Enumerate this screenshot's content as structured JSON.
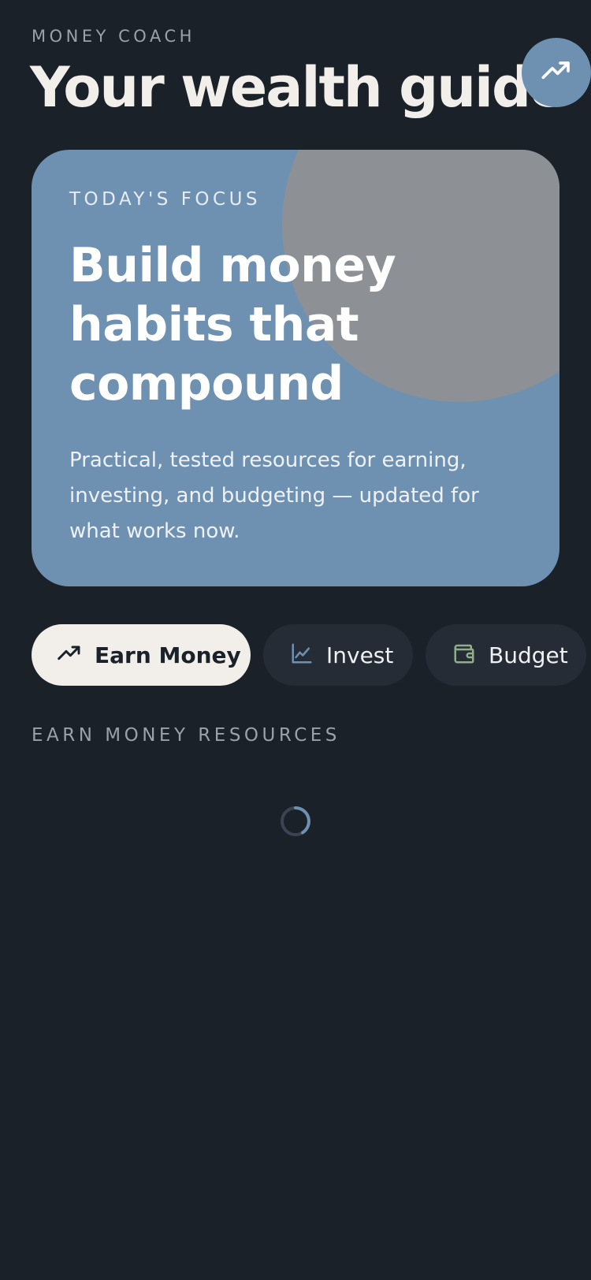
{
  "header": {
    "eyebrow": "MONEY COACH",
    "title": "Your wealth guide",
    "action_icon": "trending-up-icon"
  },
  "hero": {
    "eyebrow": "TODAY'S FOCUS",
    "title": "Build money habits that compound",
    "description": "Practical, tested resources for earning, investing, and budgeting — updated for what works now."
  },
  "categories": [
    {
      "label": "Earn Money",
      "icon": "trending-up-icon",
      "selected": true
    },
    {
      "label": "Invest",
      "icon": "line-chart-icon",
      "selected": false
    },
    {
      "label": "Budget",
      "icon": "wallet-icon",
      "selected": false
    }
  ],
  "section": {
    "label": "EARN MONEY RESOURCES",
    "loading": true
  },
  "colors": {
    "background": "#1b2129",
    "accent": "#6e91b2",
    "hero_circle": "#8d9195",
    "chip_selected": "#f2efea",
    "chip_default": "#252c36",
    "invest_icon": "#6e91b2",
    "budget_icon": "#8fae8a"
  }
}
